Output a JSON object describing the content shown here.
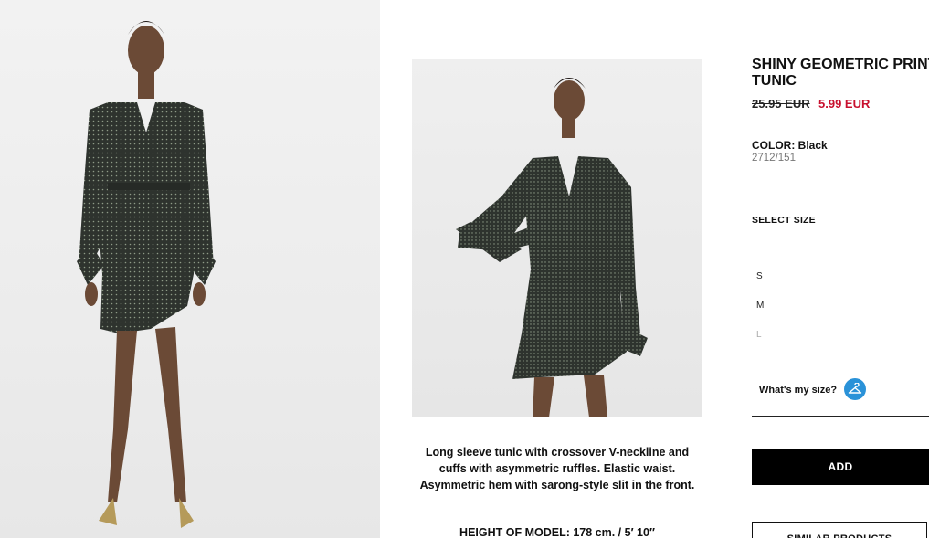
{
  "product": {
    "title_line1": "SHINY GEOMETRIC PRINT",
    "title_line2": "TUNIC",
    "price_old": "25.95 EUR",
    "price_new": "5.99 EUR",
    "color_label": "COLOR:",
    "color_value": "Black",
    "reference": "2712/151",
    "select_size_label": "SELECT SIZE",
    "sizes": [
      {
        "label": "S",
        "available": true
      },
      {
        "label": "M",
        "available": true
      },
      {
        "label": "L",
        "available": false
      }
    ],
    "whats_my_size": "What's my size?",
    "add_label": "ADD",
    "similar_label": "SIMILAR PRODUCTS"
  },
  "description": {
    "text": "Long sleeve tunic with crossover V-neckline and cuffs with asymmetric ruffles. Elastic waist. Asymmetric hem with sarong-style slit in the front.",
    "model_height": "HEIGHT OF MODEL: 178 cm. / 5′ 10″"
  },
  "colors": {
    "sale_red": "#c8102e",
    "size_help_blue": "#2a92d8",
    "dress": "#2e332e"
  },
  "icons": [
    "hanger-icon"
  ]
}
